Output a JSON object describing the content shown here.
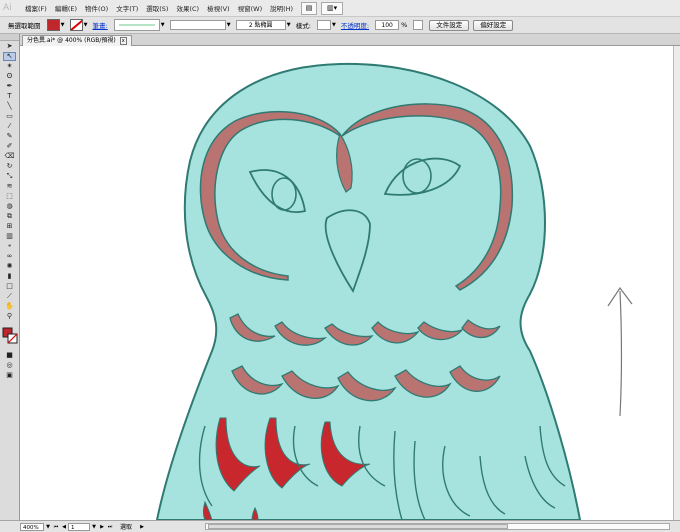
{
  "menubar": {
    "logo": "Ai",
    "items": [
      "檔案(F)",
      "編輯(E)",
      "物件(O)",
      "文字(T)",
      "選取(S)",
      "效果(C)",
      "檢視(V)",
      "視窗(W)",
      "說明(H)"
    ]
  },
  "controlbar": {
    "selection_label": "無選取範圍",
    "stroke_label": "筆畫:",
    "brush_value": "2 點橢圓",
    "style_label": "樣式:",
    "opacity_label": "不透明度:",
    "opacity_value": "100",
    "opacity_unit": "%",
    "document_setup_button": "文件設定",
    "preferences_button": "偏好設定",
    "colors": {
      "fill": "#c0272d",
      "stroke_sample": "#b7e4c7"
    }
  },
  "document": {
    "tab_title": "分色異.ai* @ 400% (RGB/預視)",
    "close_glyph": "x"
  },
  "statusbar": {
    "zoom": "400%",
    "artboard": "1",
    "status_text": "選取"
  },
  "artwork": {
    "colors": {
      "body": "#a7e3de",
      "outline": "#2f7a73",
      "brows": "#b97371",
      "feathers_red": "#c8272d"
    }
  }
}
